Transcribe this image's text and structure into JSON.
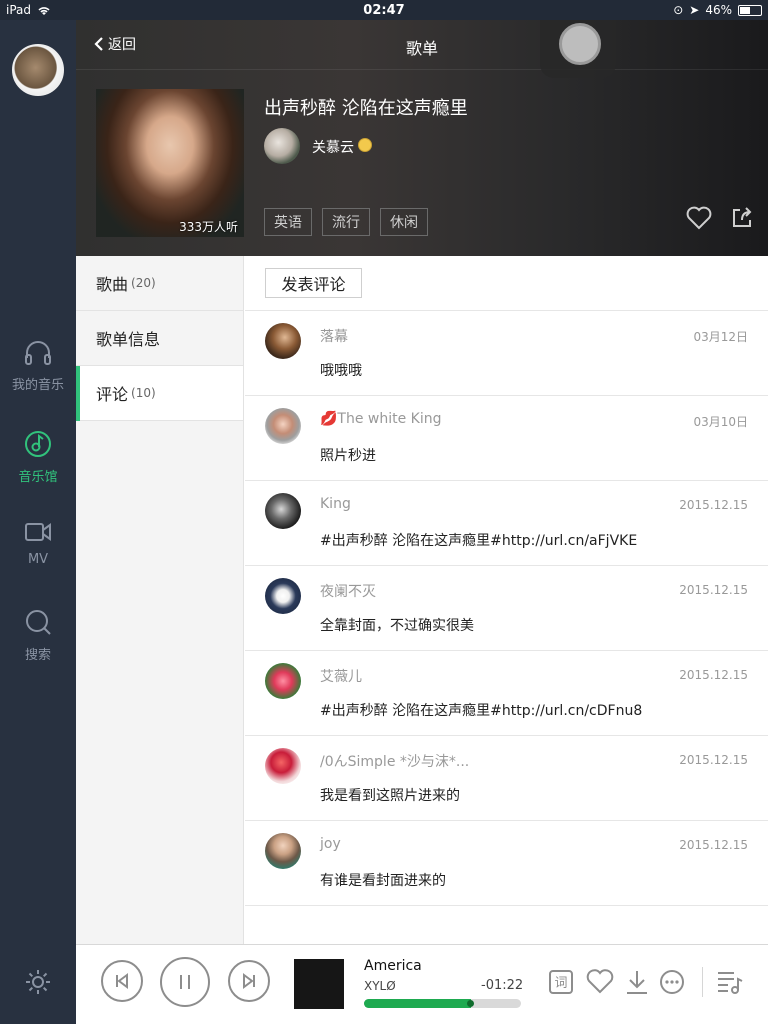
{
  "status": {
    "device": "iPad",
    "time": "02:47",
    "battery": "46%"
  },
  "sidebar": {
    "items": [
      {
        "label": "我的音乐",
        "icon": "headphones-icon"
      },
      {
        "label": "音乐馆",
        "icon": "music-note-icon",
        "active": true
      },
      {
        "label": "MV",
        "icon": "video-icon"
      },
      {
        "label": "搜索",
        "icon": "search-icon"
      }
    ]
  },
  "header": {
    "back_label": "返回",
    "title": "歌单",
    "playlist_title": "出声秒醉 沦陷在这声瘾里",
    "author": "关慕云",
    "listen_count": "333万人听",
    "tags": [
      "英语",
      "流行",
      "休闲"
    ]
  },
  "tabs": [
    {
      "label": "歌曲",
      "count": "(20)"
    },
    {
      "label": "歌单信息",
      "count": ""
    },
    {
      "label": "评论",
      "count": "(10)",
      "active": true
    }
  ],
  "comments": {
    "post_button": "发表评论",
    "items": [
      {
        "name": "落幕",
        "date": "03月12日",
        "text": "哦哦哦"
      },
      {
        "name": "💋The white King",
        "date": "03月10日",
        "text": "照片秒进"
      },
      {
        "name": "King",
        "date": "2015.12.15",
        "text": "#出声秒醉 沦陷在这声瘾里#http://url.cn/aFjVKE"
      },
      {
        "name": "夜阑不灭",
        "date": "2015.12.15",
        "text": "全靠封面，不过确实很美"
      },
      {
        "name": "艾薇儿",
        "date": "2015.12.15",
        "text": "#出声秒醉 沦陷在这声瘾里#http://url.cn/cDFnu8"
      },
      {
        "name": "/0んSimple *沙与沫*...",
        "date": "2015.12.15",
        "text": "我是看到这照片进来的"
      },
      {
        "name": "joy",
        "date": "2015.12.15",
        "text": "有谁是看封面进来的"
      }
    ]
  },
  "player": {
    "song": "America",
    "artist": "XYLØ",
    "remaining": "-01:22",
    "progress": 0.68,
    "accent": "#31c27c"
  }
}
